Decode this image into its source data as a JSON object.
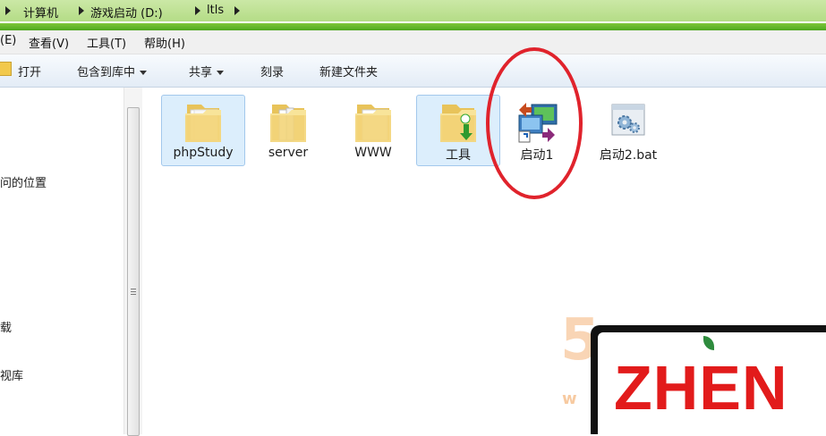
{
  "address_bar": {
    "segments": [
      "计算机",
      "游戏启动 (D:)",
      "ltls"
    ]
  },
  "menubar": {
    "items": [
      "(E)",
      "查看(V)",
      "工具(T)",
      "帮助(H)"
    ]
  },
  "toolbar": {
    "open": "打开",
    "include_library": "包含到库中",
    "share": "共享",
    "burn": "刻录",
    "new_folder": "新建文件夹"
  },
  "nav_pane": {
    "items": [
      "问的位置",
      "载",
      "视库"
    ]
  },
  "files": [
    {
      "name": "phpStudy",
      "type": "folder",
      "selected": true
    },
    {
      "name": "server",
      "type": "folder",
      "selected": false
    },
    {
      "name": "WWW",
      "type": "folder",
      "selected": false
    },
    {
      "name": "工具",
      "type": "folder",
      "selected": true
    },
    {
      "name": "启动1",
      "type": "shortcut",
      "selected": false
    },
    {
      "name": "启动2.bat",
      "type": "batch-file",
      "selected": false
    }
  ],
  "watermark": {
    "logo_text": "ZHEN",
    "faded_text": "5",
    "faded_url": "w"
  },
  "colors": {
    "address_green": "#b4dc86",
    "selection": "#dceefc",
    "annotation_red": "#e0232c",
    "logo_red": "#e21b1b"
  }
}
